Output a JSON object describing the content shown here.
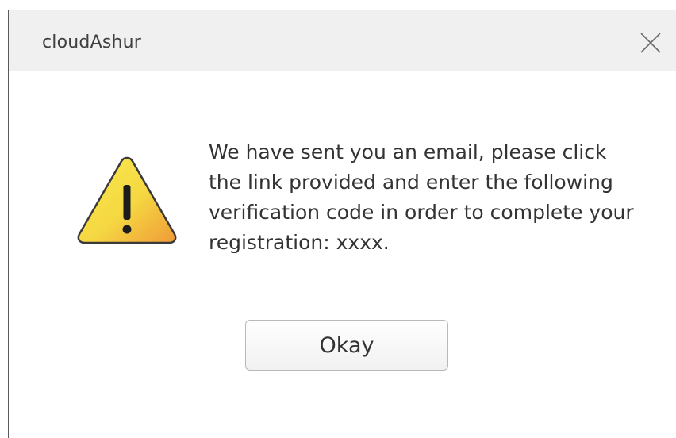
{
  "dialog": {
    "title": "cloudAshur",
    "close_icon": "close-icon",
    "warning_icon": "warning-icon",
    "message": "We have sent you an email, please click the link provided and enter the following verification code in order to complete your registration: xxxx.",
    "okay_label": "Okay"
  },
  "colors": {
    "titlebar_bg": "#f0f0f0",
    "warning_yellow": "#f5d742",
    "warning_orange": "#f0a23a",
    "text": "#333333"
  }
}
